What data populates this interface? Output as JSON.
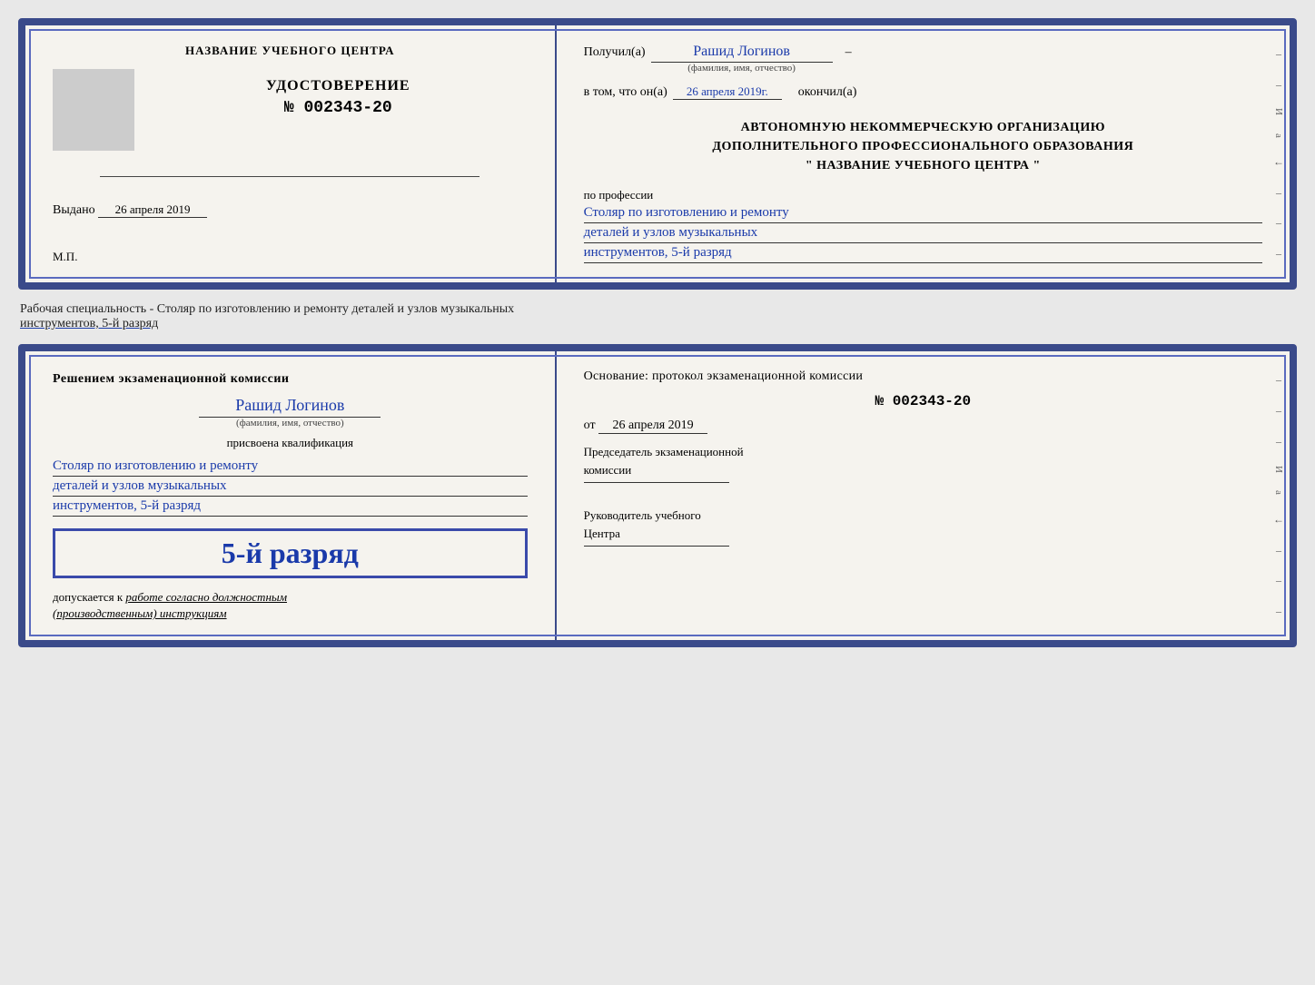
{
  "page": {
    "specialty_text": "Рабочая специальность - Столяр по изготовлению и ремонту деталей и узлов музыкальных",
    "specialty_text2": "инструментов, 5-й разряд"
  },
  "doc1": {
    "left": {
      "center_name": "НАЗВАНИЕ УЧЕБНОГО ЦЕНТРА",
      "cert_label": "УДОСТОВЕРЕНИЕ",
      "cert_number": "№ 002343-20",
      "issued_label": "Выдано",
      "issued_date": "26 апреля 2019",
      "stamp_label": "М.П."
    },
    "right": {
      "received_label": "Получил(а)",
      "name": "Рашид Логинов",
      "name_caption": "(фамилия, имя, отчество)",
      "date_label": "в том, что он(а)",
      "date_value": "26 апреля 2019г.",
      "finished_label": "окончил(а)",
      "body_line1": "АВТОНОМНУЮ НЕКОММЕРЧЕСКУЮ ОРГАНИЗАЦИЮ",
      "body_line2": "ДОПОЛНИТЕЛЬНОГО ПРОФЕССИОНАЛЬНОГО ОБРАЗОВАНИЯ",
      "body_line3": "\"   НАЗВАНИЕ УЧЕБНОГО ЦЕНТРА   \"",
      "profession_label": "по профессии",
      "profession_line1": "Столяр по изготовлению и ремонту",
      "profession_line2": "деталей и узлов музыкальных",
      "profession_line3": "инструментов, 5-й разряд"
    }
  },
  "doc2": {
    "left": {
      "decision_label": "Решением экзаменационной комиссии",
      "name": "Рашид Логинов",
      "name_caption": "(фамилия, имя, отчество)",
      "assigned_label": "присвоена квалификация",
      "qualification_line1": "Столяр по изготовлению и ремонту",
      "qualification_line2": "деталей и узлов музыкальных",
      "qualification_line3": "инструментов, 5-й разряд",
      "rank_badge": "5-й разряд",
      "допускается_label": "допускается к",
      "допускается_value": "работе согласно должностным",
      "допускается_value2": "(производственным) инструкциям"
    },
    "right": {
      "basis_label": "Основание: протокол экзаменационной комиссии",
      "protocol_number": "№  002343-20",
      "from_label": "от",
      "from_date": "26 апреля 2019",
      "chairman_line1": "Председатель экзаменационной",
      "chairman_line2": "комиссии",
      "head_line1": "Руководитель учебного",
      "head_line2": "Центра"
    }
  },
  "strips": {
    "и": "И",
    "а": "а",
    "left_arrow": "←",
    "dashes": [
      "–",
      "–",
      "–",
      "–",
      "–",
      "–",
      "–",
      "–"
    ]
  }
}
